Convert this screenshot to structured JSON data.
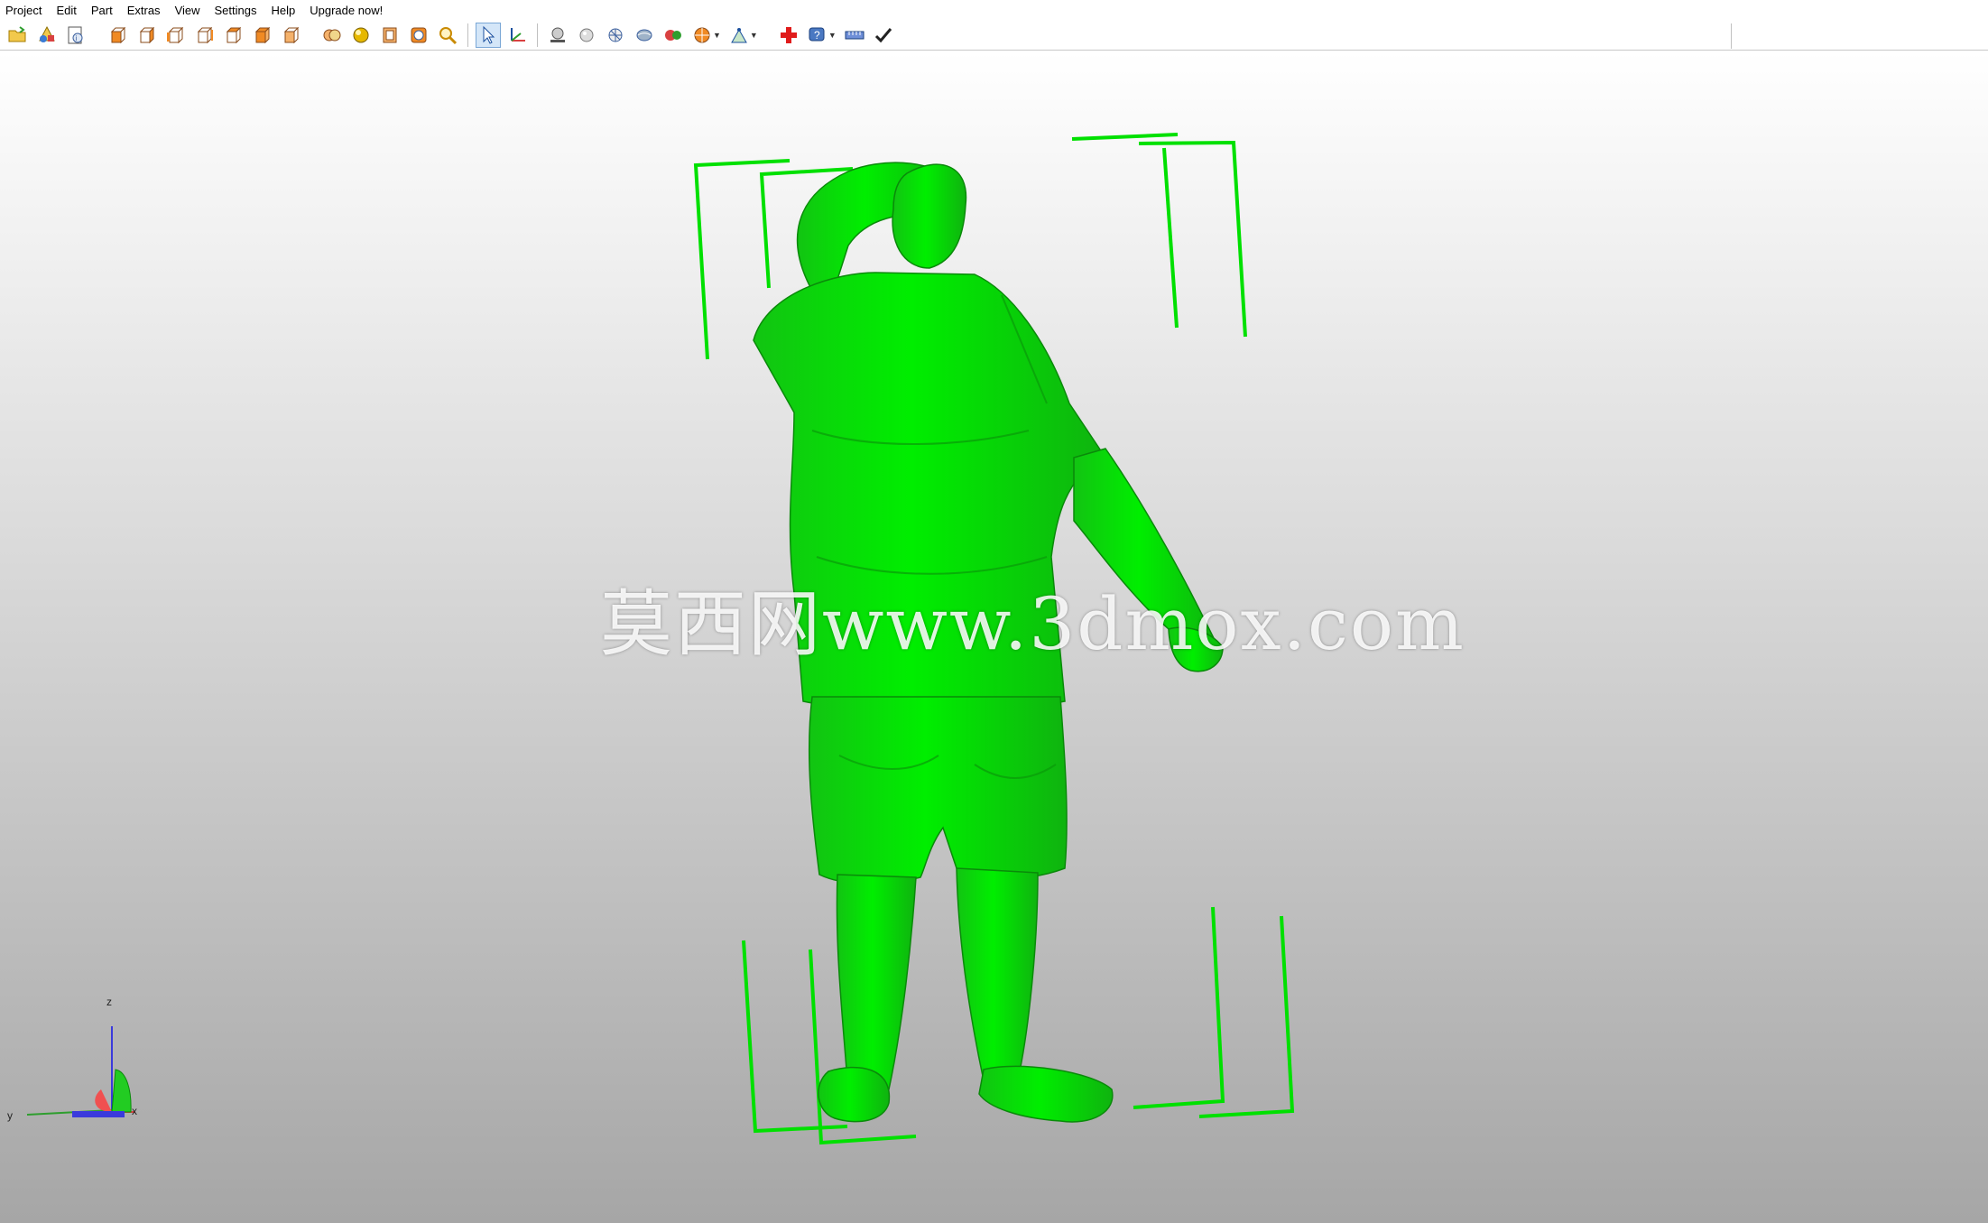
{
  "menu": {
    "items": [
      "Project",
      "Edit",
      "Part",
      "Extras",
      "View",
      "Settings",
      "Help",
      "Upgrade now!"
    ]
  },
  "toolbar": {
    "tools": [
      "open-folder-icon",
      "import-shapes-icon",
      "save-icon",
      "view-front-cube-icon",
      "view-back-cube-icon",
      "view-left-cube-icon",
      "view-right-cube-icon",
      "view-top-cube-icon",
      "view-bottom-cube-icon",
      "view-iso-cube-icon",
      "zoom-all-icon",
      "zoom-parts-icon",
      "zoom-box-icon",
      "zoom-selection-icon",
      "magnifier-icon",
      "select-pointer-icon",
      "move-axes-icon",
      "shading-icon",
      "sphere-icon",
      "mesh-icon",
      "texture-icon",
      "color-spheres-icon",
      "render-mode-icon",
      "measure-icon",
      "add-red-cross-icon",
      "help-balloon-icon",
      "ruler-icon",
      "checkmark-icon"
    ]
  },
  "viewport": {
    "model_color": "#00ee00",
    "watermark": "莫西网www.3dmox.com",
    "axes": {
      "x": "x",
      "y": "y",
      "z": "z"
    }
  }
}
